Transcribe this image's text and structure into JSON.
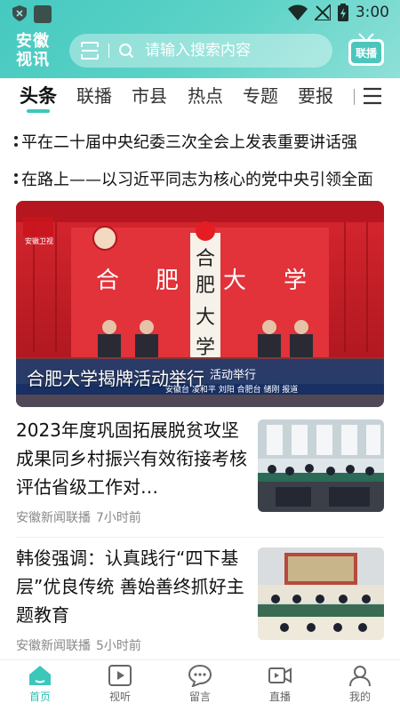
{
  "status_bar": {
    "time": "3:00"
  },
  "header": {
    "logo_line1": "安徽",
    "logo_line2": "视讯",
    "search_placeholder": "请输入搜索内容",
    "live_badge": "联播"
  },
  "tabs": [
    {
      "label": "头条",
      "active": true
    },
    {
      "label": "联播"
    },
    {
      "label": "市县"
    },
    {
      "label": "热点"
    },
    {
      "label": "专题"
    },
    {
      "label": "要报"
    }
  ],
  "tickers": [
    "平在二十届中央纪委三次全会上发表重要讲话强",
    "在路上——以习近平同志为核心的党中央引领全面"
  ],
  "hero": {
    "caption": "合肥大学揭牌活动举行",
    "sign_text": [
      "合",
      "肥",
      "大",
      "学"
    ],
    "backdrop_text": [
      "合",
      "肥",
      "大",
      "学"
    ],
    "channel_logo": "安徽卫视",
    "lower_third": "安徽台 凌和平 刘阳 合肥台 储刚 报道",
    "lower_third_top": "活动举行"
  },
  "news": [
    {
      "title": "2023年度巩固拓展脱贫攻坚成果同乡村振兴有效衔接考核评估省级工作对…",
      "source": "安徽新闻联播",
      "time": "7小时前"
    },
    {
      "title": "韩俊强调：认真践行“四下基层”优良传统 善始善终抓好主题教育",
      "source": "安徽新闻联播",
      "time": "5小时前"
    }
  ],
  "bottom_nav": [
    {
      "label": "首页",
      "icon": "home-icon",
      "active": true
    },
    {
      "label": "视听",
      "icon": "play-icon"
    },
    {
      "label": "留言",
      "icon": "chat-icon"
    },
    {
      "label": "直播",
      "icon": "live-camera-icon"
    },
    {
      "label": "我的",
      "icon": "user-icon"
    }
  ],
  "colors": {
    "accent": "#3cc7bb",
    "header": "#52cfc3",
    "hero_red": "#c8242c"
  }
}
